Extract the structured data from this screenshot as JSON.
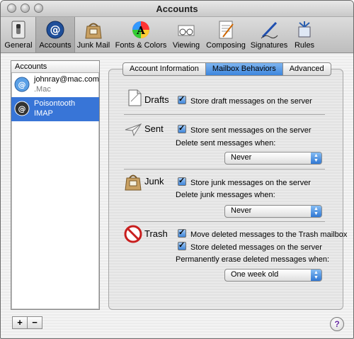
{
  "window": {
    "title": "Accounts"
  },
  "toolbar": {
    "items": [
      {
        "label": "General",
        "icon": "switch-icon"
      },
      {
        "label": "Accounts",
        "icon": "at-sign-icon"
      },
      {
        "label": "Junk Mail",
        "icon": "junk-mail-bag-icon"
      },
      {
        "label": "Fonts & Colors",
        "icon": "color-wheel-icon"
      },
      {
        "label": "Viewing",
        "icon": "glasses-icon"
      },
      {
        "label": "Composing",
        "icon": "document-pencil-icon"
      },
      {
        "label": "Signatures",
        "icon": "pen-icon"
      },
      {
        "label": "Rules",
        "icon": "rules-icon"
      }
    ],
    "selected": "Accounts"
  },
  "sidebar": {
    "header": "Accounts",
    "accounts": [
      {
        "name": "johnray@mac.com",
        "type": ".Mac",
        "selected": false
      },
      {
        "name": "Poisontooth",
        "type": "IMAP",
        "selected": true
      }
    ],
    "add_label": "+",
    "remove_label": "−"
  },
  "tabs": [
    {
      "label": "Account Information",
      "active": false
    },
    {
      "label": "Mailbox Behaviors",
      "active": true
    },
    {
      "label": "Advanced",
      "active": false
    }
  ],
  "sections": {
    "drafts": {
      "label": "Drafts",
      "checkbox": "Store draft messages on the server"
    },
    "sent": {
      "label": "Sent",
      "checkbox": "Store sent messages on the server",
      "delete_label": "Delete sent messages when:",
      "popup_value": "Never"
    },
    "junk": {
      "label": "Junk",
      "checkbox": "Store junk messages on the server",
      "delete_label": "Delete junk messages when:",
      "popup_value": "Never"
    },
    "trash": {
      "label": "Trash",
      "checkbox_move": "Move deleted messages to the Trash mailbox",
      "checkbox_store": "Store deleted messages on the server",
      "erase_label": "Permanently erase deleted messages when:",
      "popup_value": "One week old"
    }
  },
  "help": {
    "label": "?"
  },
  "colors": {
    "selection": "#3875d7",
    "accent": "#3d86de"
  }
}
